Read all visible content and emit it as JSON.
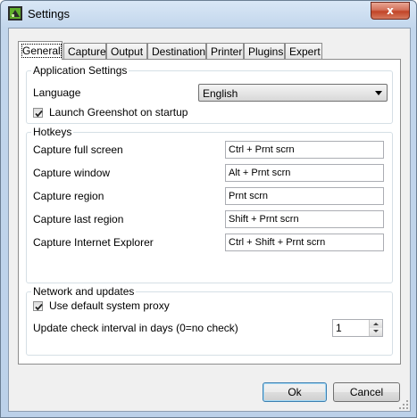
{
  "window": {
    "title": "Settings",
    "close_glyph": "x"
  },
  "tabs": [
    {
      "label": "General",
      "active": true
    },
    {
      "label": "Capture"
    },
    {
      "label": "Output"
    },
    {
      "label": "Destination"
    },
    {
      "label": "Printer"
    },
    {
      "label": "Plugins"
    },
    {
      "label": "Expert"
    }
  ],
  "application_settings": {
    "title": "Application Settings",
    "language_label": "Language",
    "language_value": "English",
    "launch_label": "Launch Greenshot on startup",
    "launch_checked": true
  },
  "hotkeys": {
    "title": "Hotkeys",
    "items": [
      {
        "label": "Capture full screen",
        "value": "Ctrl + Prnt scrn"
      },
      {
        "label": "Capture window",
        "value": "Alt + Prnt scrn"
      },
      {
        "label": "Capture region",
        "value": "Prnt scrn"
      },
      {
        "label": "Capture last region",
        "value": "Shift + Prnt scrn"
      },
      {
        "label": "Capture Internet Explorer",
        "value": "Ctrl + Shift + Prnt scrn"
      }
    ]
  },
  "network": {
    "title": "Network and updates",
    "proxy_label": "Use default system proxy",
    "proxy_checked": true,
    "interval_label": "Update check interval in days (0=no check)",
    "interval_value": "1"
  },
  "buttons": {
    "ok": "Ok",
    "cancel": "Cancel"
  },
  "icons": {
    "app": "greenshot-icon",
    "close": "close-icon",
    "check": "checkmark-icon"
  }
}
